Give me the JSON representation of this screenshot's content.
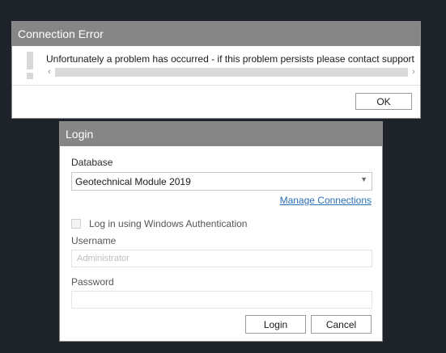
{
  "error_dialog": {
    "title": "Connection Error",
    "icon": "exclamation-icon",
    "message": "Unfortunately a problem has occurred - if this problem persists please contact support",
    "ok_label": "OK"
  },
  "login_dialog": {
    "title": "Login",
    "database_label": "Database",
    "database_value": "Geotechnical Module 2019",
    "manage_connections_label": "Manage Connections",
    "windows_auth_label": "Log in using Windows Authentication",
    "username_label": "Username",
    "username_value": "Administrator",
    "password_label": "Password",
    "password_value": "",
    "login_label": "Login",
    "cancel_label": "Cancel"
  },
  "colors": {
    "title_bar": "#868686",
    "background": "#1e2229",
    "link": "#2a6fb5"
  }
}
